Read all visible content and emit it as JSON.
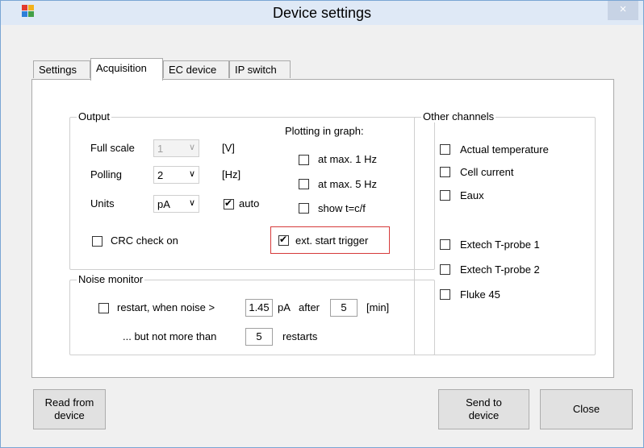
{
  "window": {
    "title": "Device settings",
    "close_glyph": "×"
  },
  "tabs": [
    "Settings",
    "Acquisition",
    "EC device",
    "IP switch"
  ],
  "output": {
    "group_title": "Output",
    "full_scale": {
      "label": "Full scale",
      "value": "1",
      "unit": "[V]"
    },
    "polling": {
      "label": "Polling",
      "value": "2",
      "unit": "[Hz]"
    },
    "units": {
      "label": "Units",
      "value": "pA",
      "auto_label": "auto",
      "auto_checked": true
    },
    "plotting_label": "Plotting in graph:",
    "plot_options": [
      "at max. 1 Hz",
      "at max. 5 Hz",
      "show t=c/f"
    ],
    "crc_label": "CRC check on",
    "ext_trigger_label": "ext. start trigger",
    "ext_trigger_checked": true
  },
  "noise": {
    "group_title": "Noise monitor",
    "restart_label": "restart, when noise >",
    "threshold": "1.45",
    "unit": "pA",
    "after_label": "after",
    "after_value": "5",
    "min_label": "[min]",
    "not_more_label": "... but not more than",
    "restarts_value": "5",
    "restarts_label": "restarts"
  },
  "other_channels": {
    "group_title": "Other channels",
    "items": [
      "Actual temperature",
      "Cell current",
      "Eaux",
      "Extech T-probe 1",
      "Extech T-probe 2",
      "Fluke 45"
    ]
  },
  "buttons": {
    "read_from_device": "Read from\ndevice",
    "send_to_device": "Send to\ndevice",
    "close": "Close"
  }
}
